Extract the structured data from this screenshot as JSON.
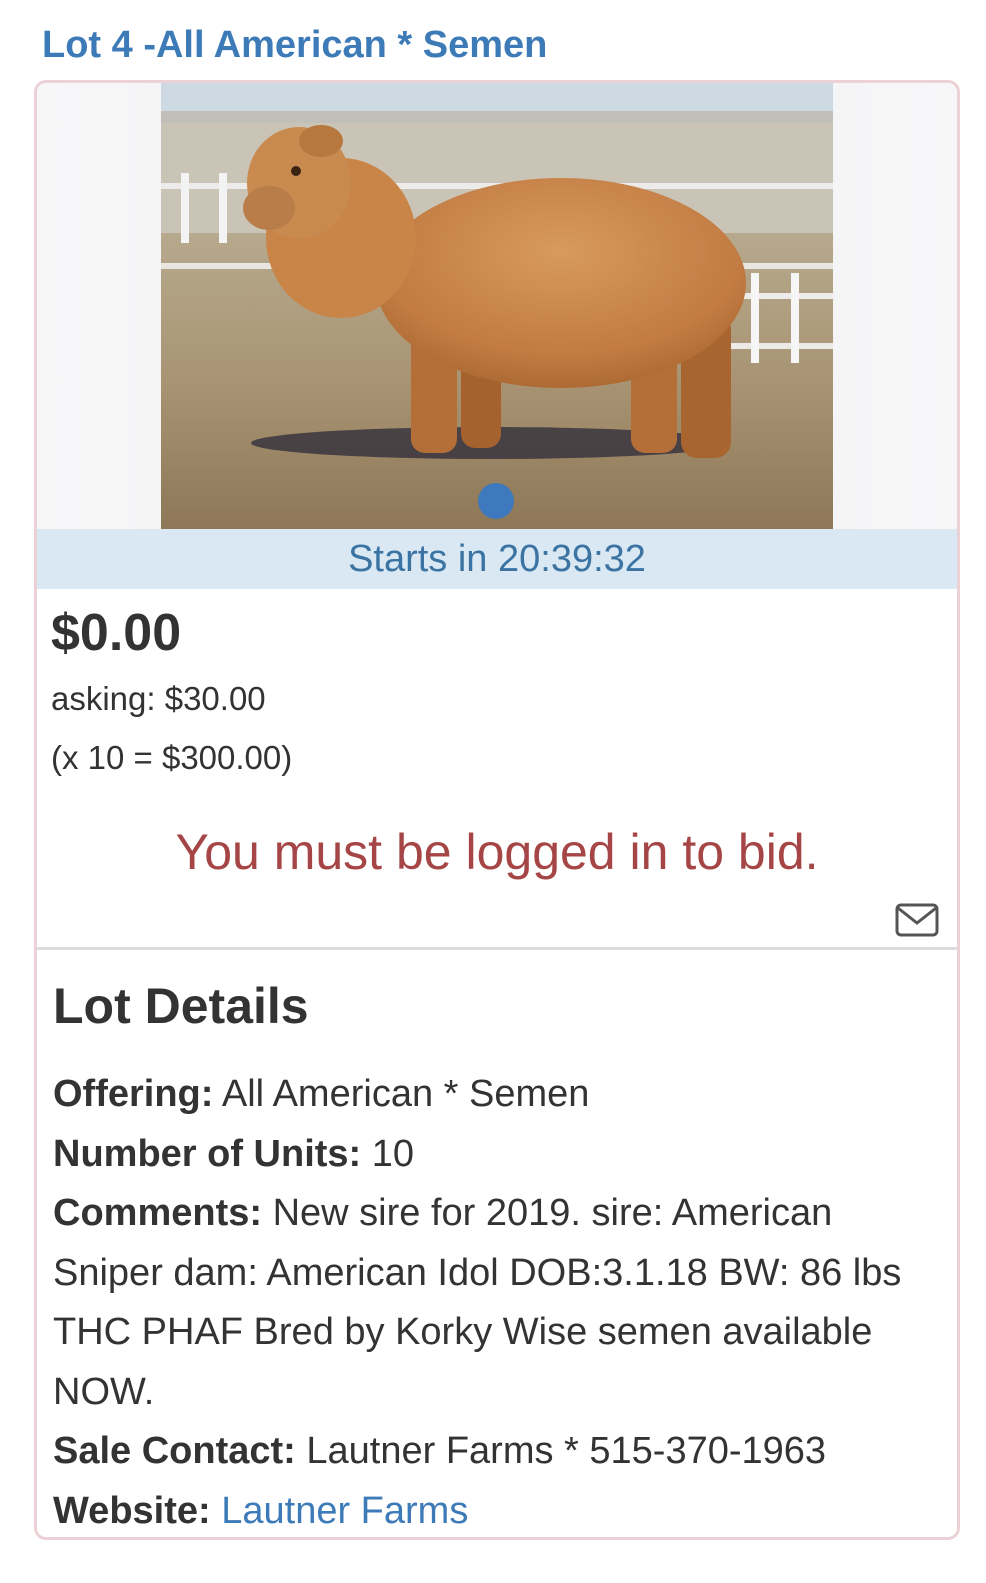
{
  "lot": {
    "title": "Lot 4 -All American * Semen",
    "starts_in": "Starts in 20:39:32",
    "current_price": "$0.00",
    "asking": "asking: $30.00",
    "multiplier": "(x 10 = $300.00)",
    "login_message": "You must be logged in to bid.",
    "email_icon": "envelope-icon",
    "image_count": 1
  },
  "details": {
    "heading": "Lot Details",
    "offering_label": "Offering:",
    "offering_value": " All American * Semen",
    "units_label": "Number of Units:",
    "units_value": " 10",
    "comments_label": "Comments:",
    "comments_value": " New sire for 2019. sire: American Sniper dam: American Idol DOB:3.1.18 BW: 86 lbs THC PHAF Bred by Korky Wise semen available NOW.",
    "contact_label": "Sale Contact:",
    "contact_value": " Lautner Farms * 515-370-1963",
    "website_label": "Website:",
    "website_link": "Lautner Farms"
  },
  "colors": {
    "link_blue": "#3d7ab8",
    "banner_bg": "#d9e8f3",
    "error_red": "#a54545",
    "card_border": "#ecd2d6",
    "dot_blue": "#3e78bd"
  }
}
